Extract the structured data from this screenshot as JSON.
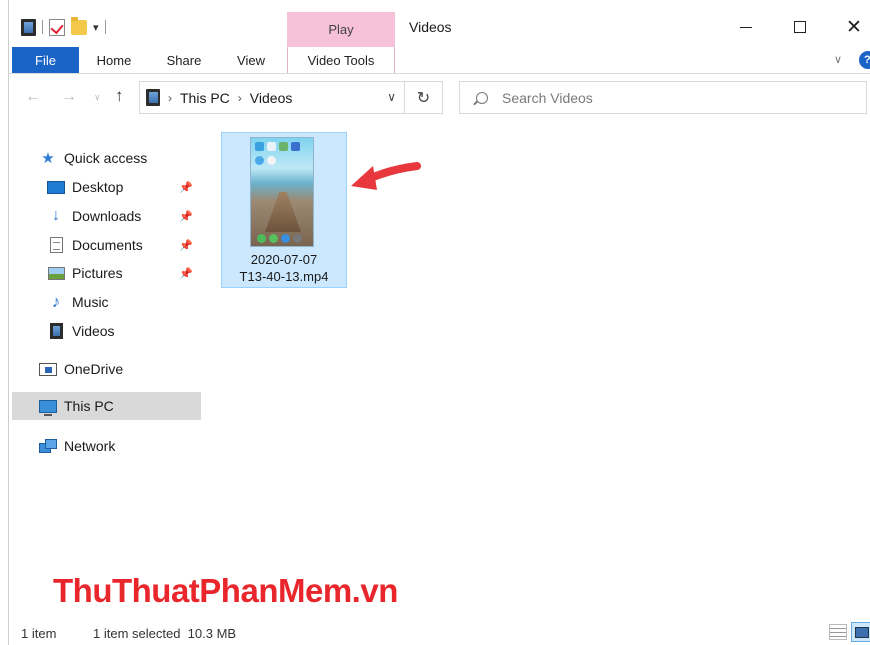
{
  "window": {
    "title": "Videos",
    "contextual_tab": "Play",
    "controls": {
      "minimize": "—",
      "maximize": "☐",
      "close": "✕"
    }
  },
  "ribbon": {
    "tabs": [
      "File",
      "Home",
      "Share",
      "View",
      "Video Tools"
    ],
    "active_tab": "File",
    "accent_color": "#1a63c7",
    "contextual_color": "#f6c1d9"
  },
  "address": {
    "crumbs": [
      "This PC",
      "Videos"
    ],
    "search_placeholder": "Search Videos"
  },
  "navpane": {
    "quick_access": "Quick access",
    "items": [
      {
        "label": "Desktop",
        "icon": "desktop-icon",
        "pinned": true
      },
      {
        "label": "Downloads",
        "icon": "download-icon",
        "pinned": true
      },
      {
        "label": "Documents",
        "icon": "documents-icon",
        "pinned": true
      },
      {
        "label": "Pictures",
        "icon": "pictures-icon",
        "pinned": true
      },
      {
        "label": "Music",
        "icon": "music-icon",
        "pinned": false
      },
      {
        "label": "Videos",
        "icon": "videos-icon",
        "pinned": false
      }
    ],
    "onedrive": "OneDrive",
    "this_pc": "This PC",
    "network": "Network",
    "selected": "This PC"
  },
  "content": {
    "files": [
      {
        "name_line1": "2020-07-07",
        "name_line2": "T13-40-13.mp4",
        "selected": true
      }
    ],
    "annotation_arrow_color": "#e8383d"
  },
  "watermark": {
    "part1": "ThuThuat",
    "part2": "PhanMem",
    "part3": ".vn"
  },
  "statusbar": {
    "count": "1 item",
    "selection": "1 item selected  10.3 MB"
  }
}
